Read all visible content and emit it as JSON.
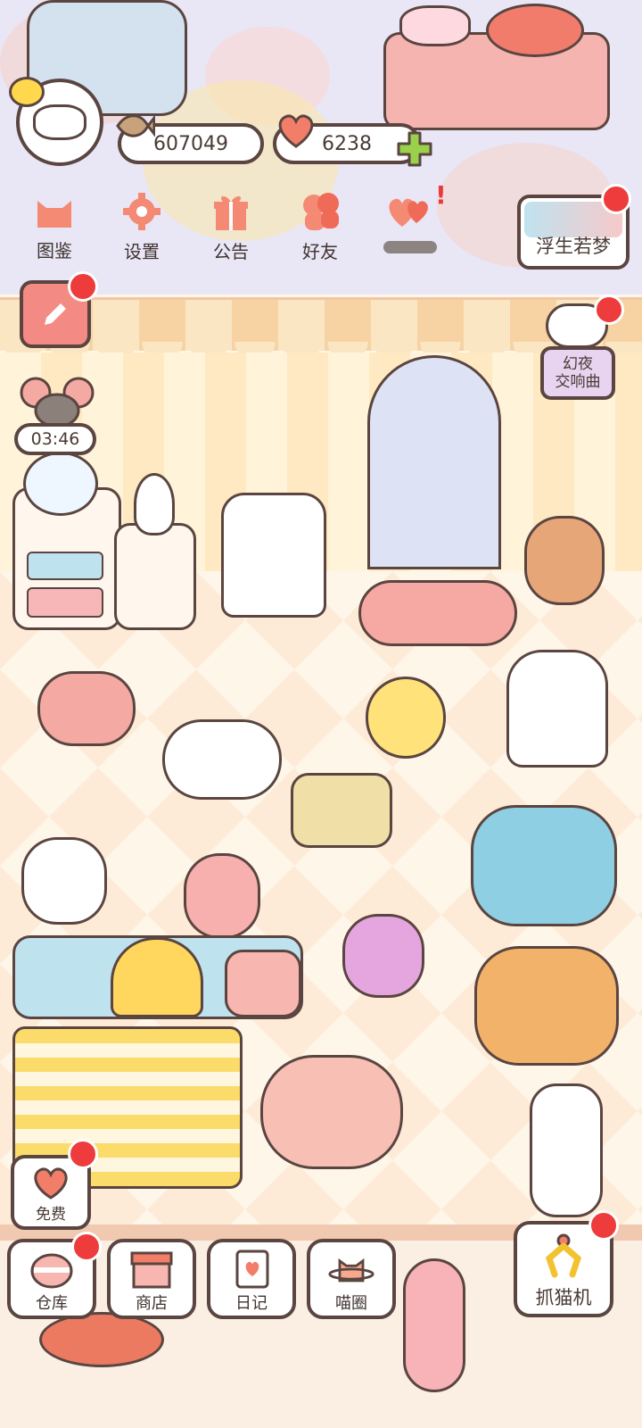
{
  "hud": {
    "fish_currency": "607049",
    "heart_currency": "6238"
  },
  "menu": [
    {
      "label": "图鉴"
    },
    {
      "label": "设置"
    },
    {
      "label": "公告"
    },
    {
      "label": "好友"
    },
    {
      "label": ""
    }
  ],
  "side": {
    "dream_label": "浮生若梦",
    "night_label_1": "幻夜",
    "night_label_2": "交响曲",
    "timer": "03:46"
  },
  "buttons": {
    "free": "免费",
    "warehouse": "仓库",
    "shop": "商店",
    "diary": "日记",
    "cat_circle": "喵圈",
    "claw": "抓猫机"
  },
  "colors": {
    "outline": "#5a4540",
    "accent": "#f27e6a",
    "notify": "#ee3b3b",
    "plus": "#9ad14b"
  }
}
